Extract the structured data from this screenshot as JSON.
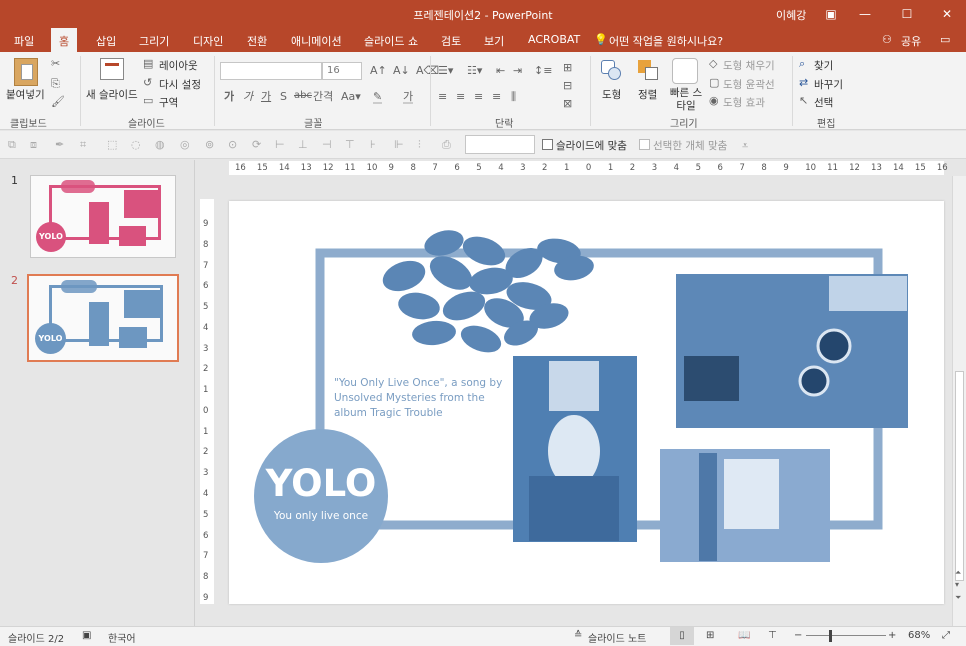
{
  "window": {
    "title": "프레젠테이션2  -  PowerPoint",
    "user": "이혜강"
  },
  "tabs": [
    "파일",
    "홈",
    "삽입",
    "그리기",
    "디자인",
    "전환",
    "애니메이션",
    "슬라이드 쇼",
    "검토",
    "보기",
    "ACROBAT"
  ],
  "tell_me": "어떤 작업을 원하시나요?",
  "share": "공유",
  "ribbon": {
    "clipboard": {
      "paste": "붙여넣기",
      "label": "클립보드"
    },
    "slides": {
      "new_slide": "새 슬라이드",
      "layout": "레이아웃",
      "reset": "다시 설정",
      "section": "구역",
      "label": "슬라이드"
    },
    "font": {
      "size": "16",
      "strike_label": "abc",
      "spacing": "간격",
      "label": "글꼴"
    },
    "paragraph": {
      "label": "단락"
    },
    "drawing": {
      "shapes": "도형",
      "arrange": "정렬",
      "quick_styles": "빠른 스타일",
      "fill": "도형 채우기",
      "outline": "도형 윤곽선",
      "effects": "도형 효과",
      "label": "그리기"
    },
    "editing": {
      "find": "찾기",
      "replace": "바꾸기",
      "select": "선택",
      "label": "편집"
    }
  },
  "quickbar": {
    "fit_slide": "슬라이드에 맞춤",
    "fit_selected": "선택한 개체 맞춤"
  },
  "ruler": {
    "h_labels": [
      "16",
      "15",
      "14",
      "13",
      "12",
      "11",
      "10",
      "9",
      "8",
      "7",
      "6",
      "5",
      "4",
      "3",
      "2",
      "1",
      "0",
      "1",
      "2",
      "3",
      "4",
      "5",
      "6",
      "7",
      "8",
      "9",
      "10",
      "11",
      "12",
      "13",
      "14",
      "15",
      "16"
    ],
    "v_labels": [
      "9",
      "8",
      "7",
      "6",
      "5",
      "4",
      "3",
      "2",
      "1",
      "0",
      "1",
      "2",
      "3",
      "4",
      "5",
      "6",
      "7",
      "8",
      "9"
    ]
  },
  "thumbnails": [
    {
      "number": "1",
      "accent": "#d9527e"
    },
    {
      "number": "2",
      "accent": "#6d97c1"
    }
  ],
  "slide": {
    "quote": "\"You Only Live Once\", a song by Unsolved Mysteries from the album Tragic Trouble",
    "circle_title": "YOLO",
    "circle_subtitle": "You only live once",
    "thumb_title": "YOLO",
    "accent": "#86a9cd",
    "frame_color": "#8eaccd",
    "text_color": "#7a9dc2"
  },
  "status": {
    "slide_info": "슬라이드 2/2",
    "language": "한국어",
    "notes": "슬라이드 노트",
    "zoom": "68%"
  }
}
